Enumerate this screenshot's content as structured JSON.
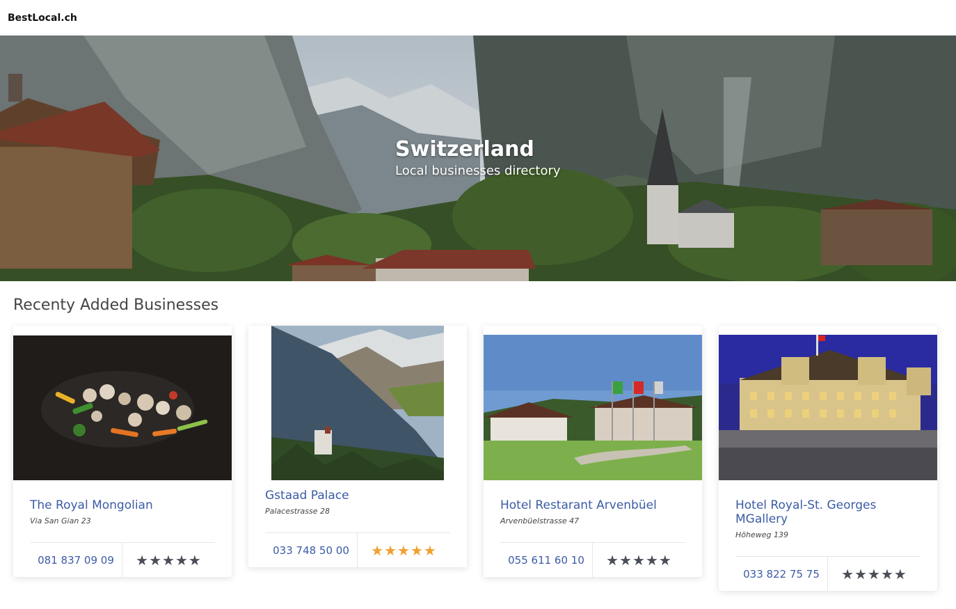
{
  "brand": "BestLocal.ch",
  "hero": {
    "title": "Switzerland",
    "subtitle": "Local businesses directory"
  },
  "section_title": "Recenty Added Businesses",
  "businesses": [
    {
      "name": "The Royal Mongolian",
      "address": "Via San Gian 23",
      "phone": "081 837 09 09",
      "rating": 5,
      "stars": "★★★★★",
      "star_color": "#4a4f57"
    },
    {
      "name": "Gstaad Palace",
      "address": "Palacestrasse 28",
      "phone": "033 748 50 00",
      "rating": 5,
      "stars": "★★★★★",
      "star_color": "#f0a030"
    },
    {
      "name": "Hotel Restarant Arvenbüel",
      "address": "Arvenbüelstrasse 47",
      "phone": "055 611 60 10",
      "rating": 5,
      "stars": "★★★★★",
      "star_color": "#4a4f57"
    },
    {
      "name": "Hotel Royal-St. Georges MGallery",
      "address": "Höheweg 139",
      "phone": "033 822 75 75",
      "rating": 5,
      "stars": "★★★★★",
      "star_color": "#4a4f57"
    }
  ]
}
